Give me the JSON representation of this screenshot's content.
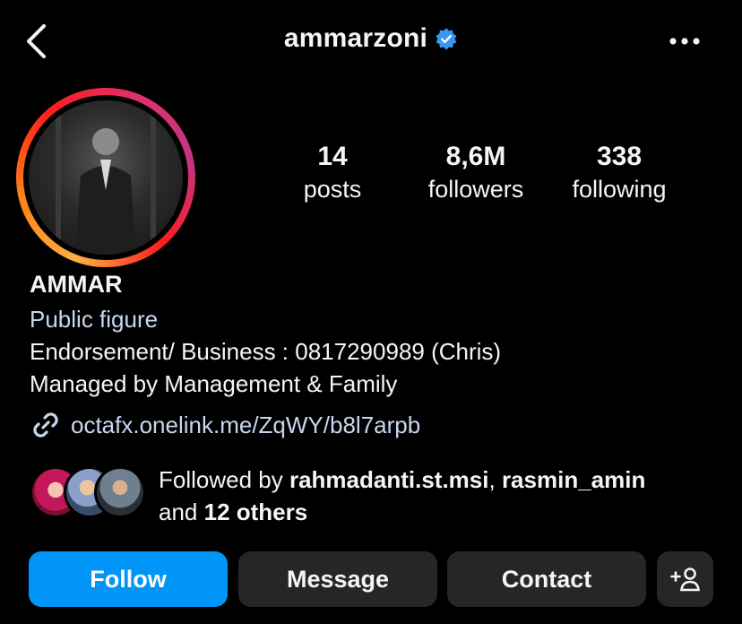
{
  "header": {
    "username": "ammarzoni",
    "verified": true,
    "back_icon": "chevron-left-icon",
    "more_icon": "more-horizontal-icon"
  },
  "stats": [
    {
      "value": "14",
      "label": "posts"
    },
    {
      "value": "8,6M",
      "label": "followers"
    },
    {
      "value": "338",
      "label": "following"
    }
  ],
  "profile": {
    "display_name": "AMMAR",
    "category": "Public figure",
    "bio_lines": [
      "Endorsement/ Business : 0817290989 (Chris)",
      "Managed by Management & Family"
    ],
    "link": "octafx.onelink.me/ZqWY/b8l7arpb"
  },
  "followed_by": {
    "prefix": "Followed by ",
    "users": [
      "rahmadanti.st.msi",
      "rasmin_amin"
    ],
    "separator": ", ",
    "and_text": "and ",
    "others": "12 others"
  },
  "actions": {
    "follow": "Follow",
    "message": "Message",
    "contact": "Contact",
    "suggest_icon": "add-person-icon"
  },
  "colors": {
    "accent": "#0095f6",
    "verified": "#3897f0",
    "link": "#c7d8ee",
    "button_bg": "#262626"
  }
}
